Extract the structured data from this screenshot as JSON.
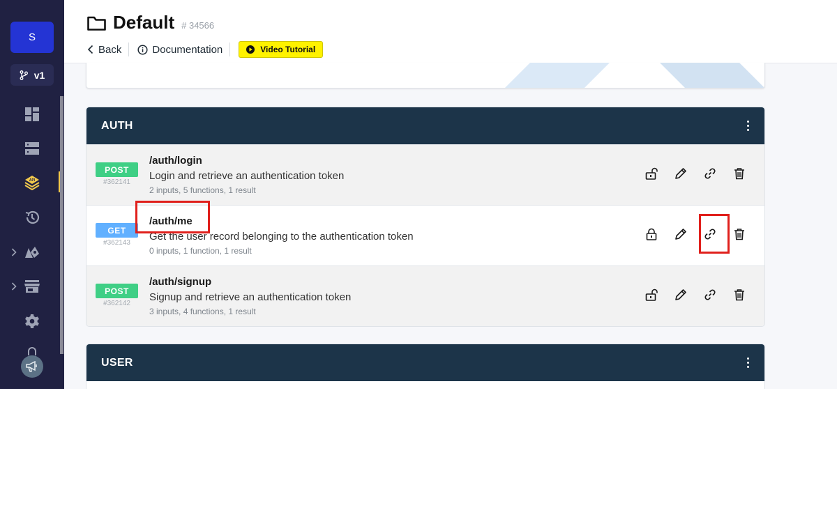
{
  "sidebar": {
    "avatar_initial": "S",
    "branch_label": "v1",
    "items": [
      {
        "icon": "dashboard-icon"
      },
      {
        "icon": "database-icon"
      },
      {
        "icon": "api-icon",
        "active": true
      },
      {
        "icon": "history-icon"
      },
      {
        "icon": "addons-icon",
        "expandable": true
      },
      {
        "icon": "marketplace-icon",
        "expandable": true
      },
      {
        "icon": "settings-icon"
      }
    ],
    "accent_color": "#f2c94c"
  },
  "header": {
    "title": "Default",
    "id": "# 34566",
    "back_label": "Back",
    "docs_label": "Documentation",
    "video_label": "Video Tutorial"
  },
  "sections": [
    {
      "title": "AUTH",
      "endpoints": [
        {
          "method": "POST",
          "id": "#362141",
          "path": "/auth/login",
          "description": "Login and retrieve an authentication token",
          "meta": "2 inputs, 5 functions, 1 result",
          "locked": false
        },
        {
          "method": "GET",
          "id": "#362143",
          "path": "/auth/me",
          "description": "Get the user record belonging to the authentication token",
          "meta": "0 inputs, 1 function, 1 result",
          "locked": true
        },
        {
          "method": "POST",
          "id": "#362142",
          "path": "/auth/signup",
          "description": "Signup and retrieve an authentication token",
          "meta": "3 inputs, 4 functions, 1 result",
          "locked": false
        }
      ]
    },
    {
      "title": "USER",
      "endpoints": []
    }
  ],
  "colors": {
    "section_header": "#1c3449",
    "post_badge": "#3fcf85",
    "get_badge": "#61b0ff",
    "highlight": "#e0201c",
    "video_button": "#fff200"
  }
}
